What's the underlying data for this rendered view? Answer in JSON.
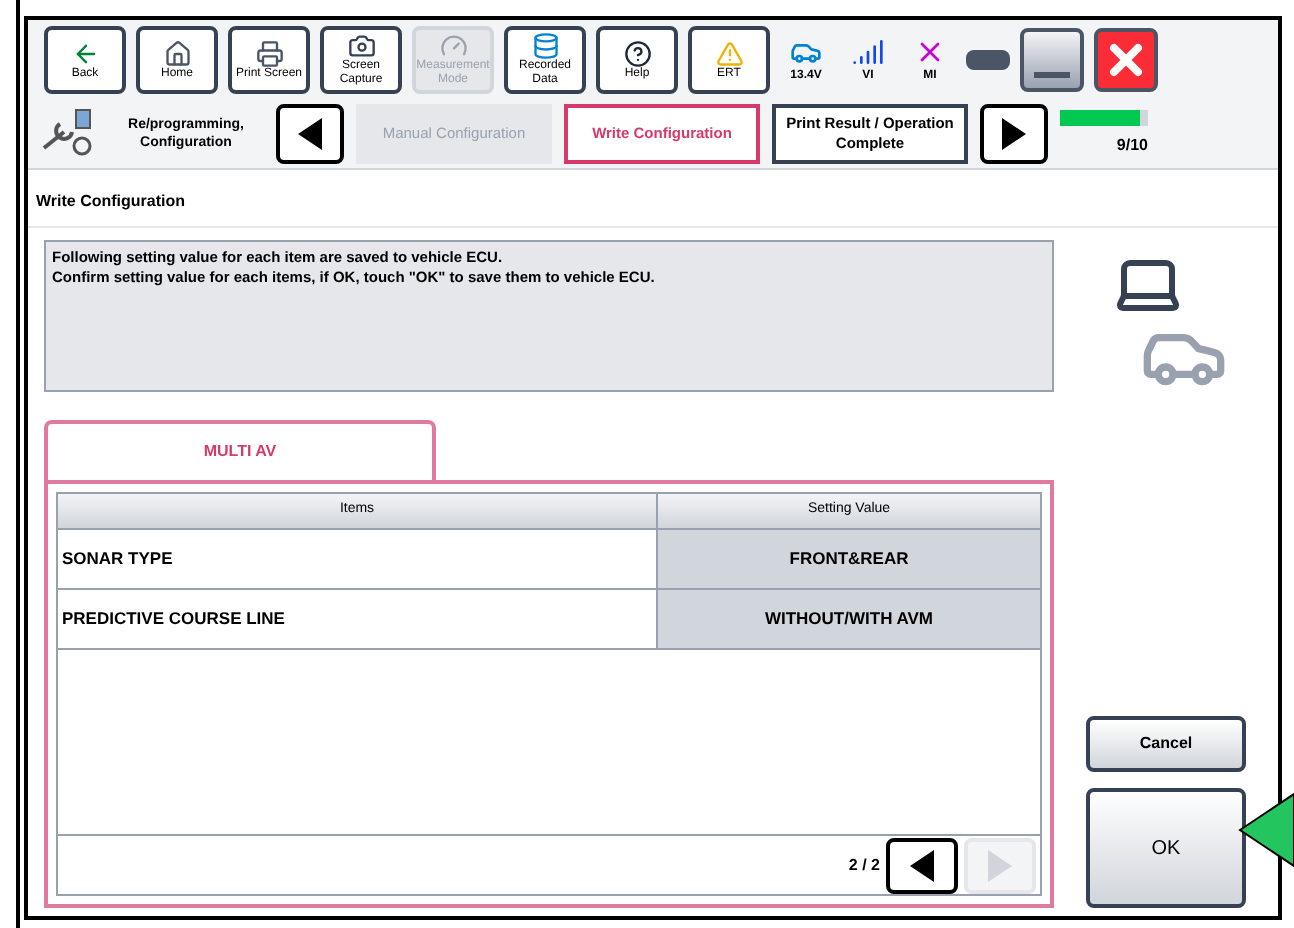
{
  "toolbar": [
    {
      "kind": "back",
      "label": "Back",
      "disabled": false
    },
    {
      "kind": "home",
      "label": "Home",
      "disabled": false
    },
    {
      "kind": "print",
      "label": "Print Screen",
      "disabled": false
    },
    {
      "kind": "camera",
      "label": "Screen Capture",
      "disabled": false
    },
    {
      "kind": "measure",
      "label": "Measurement Mode",
      "disabled": true
    },
    {
      "kind": "recorded",
      "label": "Recorded Data",
      "disabled": false
    },
    {
      "kind": "help",
      "label": "Help",
      "disabled": false
    },
    {
      "kind": "ert",
      "label": "ERT",
      "disabled": false
    }
  ],
  "status": [
    {
      "kind": "car",
      "label": "13.4V"
    },
    {
      "kind": "signal",
      "label": "VI"
    },
    {
      "kind": "cross",
      "label": "MI"
    }
  ],
  "nav": {
    "title": "Re/programming, Configuration",
    "steps": [
      {
        "label": "Manual Configuration",
        "selected": false,
        "disabled": true
      },
      {
        "label": "Write Configuration",
        "selected": true,
        "disabled": false
      },
      {
        "label": "Print Result / Operation Complete",
        "selected": false,
        "disabled": false
      }
    ],
    "progress": {
      "level": 0.9,
      "label": "9/10"
    }
  },
  "section_title": "Write Configuration",
  "message": [
    "Following setting value for each item are saved to vehicle ECU.",
    "Confirm setting value for each items, if OK, touch \"OK\" to save them to vehicle ECU."
  ],
  "tab": {
    "label": "MULTI AV",
    "selected": true
  },
  "table": {
    "columns": [
      "Items",
      "Setting Value"
    ],
    "rows": [
      [
        "SONAR TYPE",
        "FRONT&REAR"
      ],
      [
        "PREDICTIVE COURSE LINE",
        "WITHOUT/WITH AVM"
      ]
    ]
  },
  "pager": {
    "label": "2 / 2",
    "prev_disabled": false,
    "next_disabled": true
  },
  "buttons": [
    {
      "kind": "cancel",
      "label": "Cancel"
    },
    {
      "kind": "ok",
      "label": "OK"
    }
  ]
}
